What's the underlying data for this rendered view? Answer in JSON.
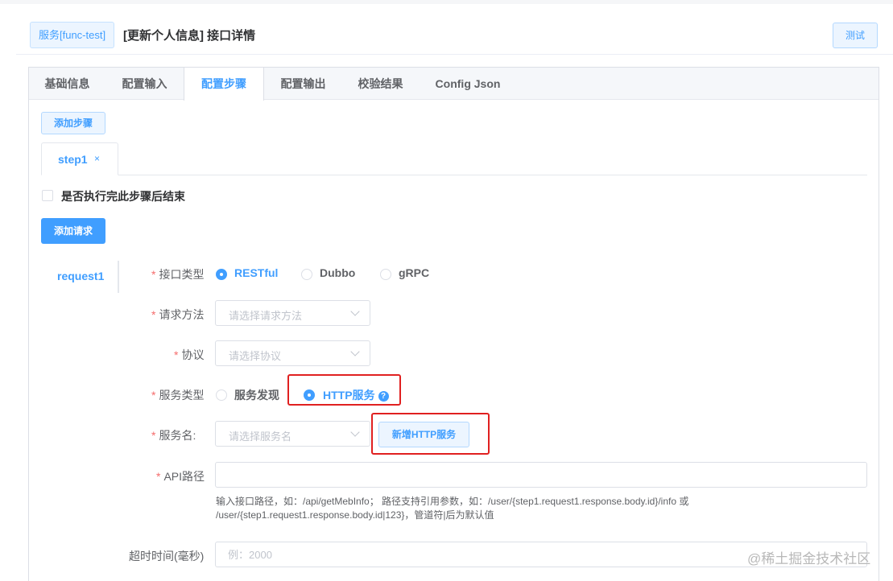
{
  "header": {
    "service_tag": "服务[func-test]",
    "title": "[更新个人信息] 接口详情",
    "test_button": "测试"
  },
  "tabs": [
    "基础信息",
    "配置输入",
    "配置步骤",
    "配置输出",
    "校验结果",
    "Config Json"
  ],
  "active_tab": "配置步骤",
  "steps": {
    "add_step_button": "添加步骤",
    "tabs": [
      {
        "label": "step1",
        "close": "×"
      }
    ],
    "end_checkbox_label": "是否执行完此步骤后结束",
    "end_checkbox_checked": false,
    "add_request_button": "添加请求"
  },
  "requests": [
    {
      "label": "request1"
    }
  ],
  "form": {
    "required_mark": "*",
    "interface_type": {
      "label": "接口类型",
      "options": [
        "RESTful",
        "Dubbo",
        "gRPC"
      ],
      "selected": "RESTful"
    },
    "method": {
      "label": "请求方法",
      "placeholder": "请选择请求方法"
    },
    "protocol": {
      "label": "协议",
      "placeholder": "请选择协议"
    },
    "service_type": {
      "label": "服务类型",
      "options": [
        "服务发现",
        "HTTP服务"
      ],
      "selected": "HTTP服务",
      "help_icon": "?"
    },
    "service_name": {
      "label": "服务名:",
      "placeholder": "请选择服务名",
      "add_button": "新增HTTP服务"
    },
    "api_path": {
      "label": "API路径",
      "value": "",
      "hint_line1": "输入接口路径，如：/api/getMebInfo； 路径支持引用参数，如：/user/{step1.request1.response.body.id}/info 或",
      "hint_line2": "/user/{step1.request1.response.body.id|123}，管道符|后为默认值"
    },
    "timeout": {
      "label": "超时时间(毫秒)",
      "placeholder": "例：2000"
    }
  },
  "watermark": "@稀土掘金技术社区",
  "colors": {
    "primary": "#409eff",
    "required": "#f56c6c",
    "highlight_box": "#e02020"
  }
}
